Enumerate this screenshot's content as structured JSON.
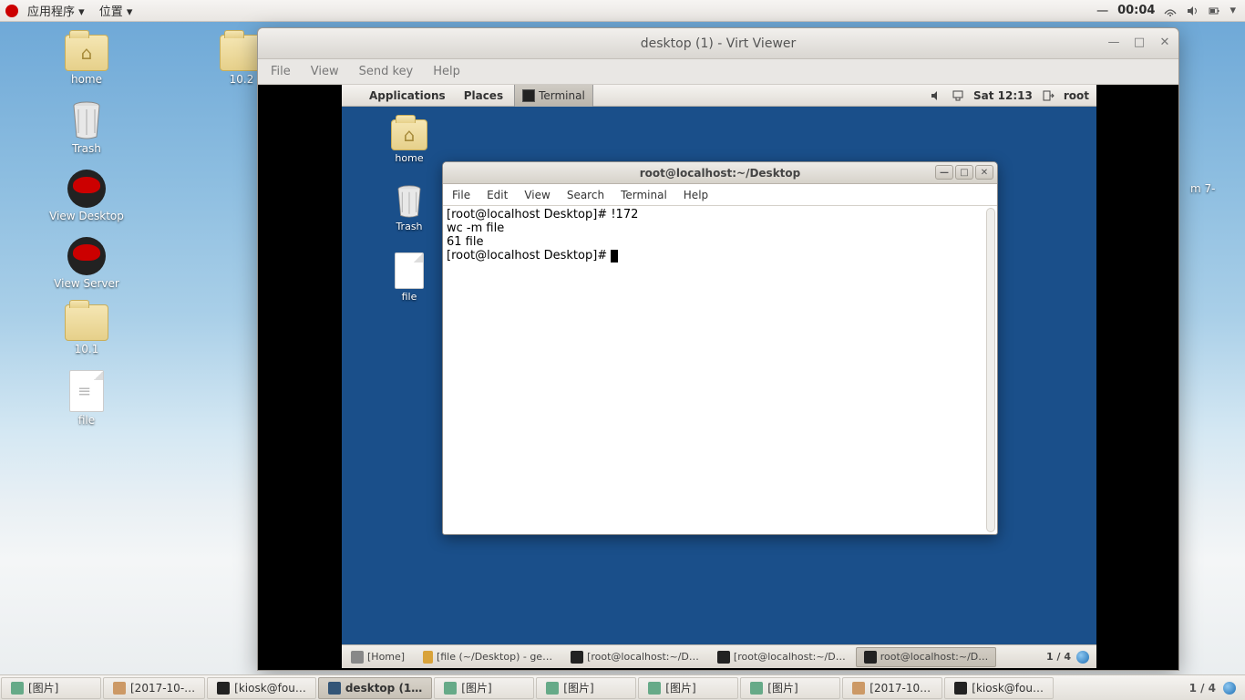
{
  "host_topbar": {
    "apps_label": "应用程序",
    "places_label": "位置",
    "clock": "00:04",
    "clock_prefix": "一"
  },
  "desktop_icons": [
    {
      "kind": "folder-home",
      "label": "home"
    },
    {
      "kind": "folder",
      "label": "10.2"
    },
    {
      "kind": "trash",
      "label": "Trash"
    },
    {
      "kind": "rh",
      "label": "View Desktop"
    },
    {
      "kind": "rh",
      "label": "View Server"
    },
    {
      "kind": "folder",
      "label": "10.1"
    },
    {
      "kind": "txt",
      "label": "file"
    }
  ],
  "right_edge_hint": "m\n7-",
  "vv": {
    "title": "desktop (1) - Virt Viewer",
    "menus": [
      "File",
      "View",
      "Send key",
      "Help"
    ]
  },
  "guest_top": {
    "apps": "Applications",
    "places": "Places",
    "active_task": "Terminal",
    "time": "Sat 12:13",
    "user": "root"
  },
  "guest_icons": [
    {
      "kind": "folder-home",
      "label": "home"
    },
    {
      "kind": "trash",
      "label": "Trash"
    },
    {
      "kind": "file",
      "label": "file"
    }
  ],
  "terminal": {
    "title": "root@localhost:~/Desktop",
    "menus": [
      "File",
      "Edit",
      "View",
      "Search",
      "Terminal",
      "Help"
    ],
    "lines": [
      "[root@localhost Desktop]# !172",
      "wc -m file",
      "61 file",
      "[root@localhost Desktop]# "
    ]
  },
  "guest_taskbar": {
    "items": [
      {
        "label": "[Home]"
      },
      {
        "label": "[file (~/Desktop) - ge…"
      },
      {
        "label": "[root@localhost:~/D…"
      },
      {
        "label": "[root@localhost:~/D…"
      },
      {
        "label": "root@localhost:~/D…",
        "active": true
      }
    ],
    "workspace": "1 / 4"
  },
  "host_dock": {
    "items": [
      {
        "label": "[图片]"
      },
      {
        "label": "[2017-10-…"
      },
      {
        "label": "[kiosk@fou…"
      },
      {
        "label": "desktop (1…",
        "active": true
      },
      {
        "label": "[图片]"
      },
      {
        "label": "[图片]"
      },
      {
        "label": "[图片]"
      },
      {
        "label": "[图片]"
      },
      {
        "label": "[2017-10…"
      },
      {
        "label": "[kiosk@fou…"
      }
    ],
    "workspace": "1 / 4"
  }
}
